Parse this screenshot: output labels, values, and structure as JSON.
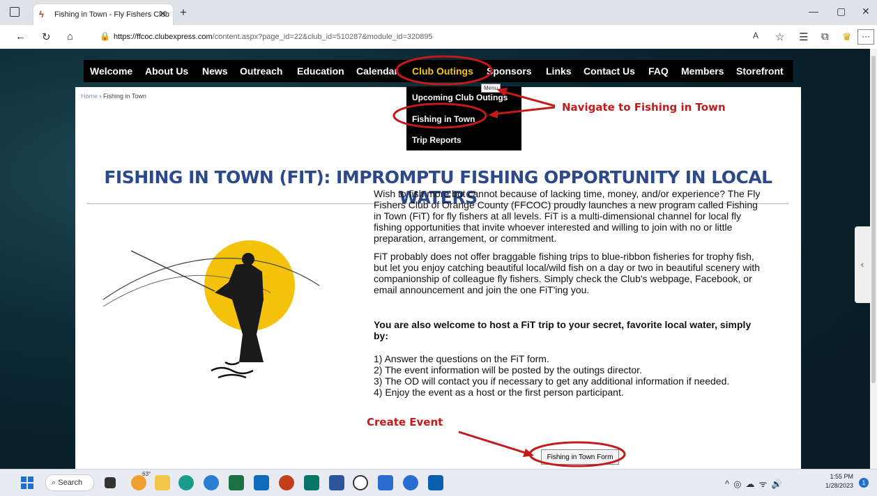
{
  "browser": {
    "tab_title": "Fishing in Town - Fly Fishers Club",
    "url_base": "https://ffcoc.clubexpress.com",
    "url_path": "/content.aspx?page_id=22&club_id=510287&module_id=320895"
  },
  "menu": {
    "items": [
      "Welcome",
      "About Us",
      "News",
      "Outreach",
      "Education",
      "Calendar",
      "Club Outings",
      "Sponsors",
      "Links",
      "Contact Us",
      "FAQ",
      "Members",
      "Storefront"
    ],
    "active": "Club Outings",
    "tooltip": "Menu"
  },
  "dropdown": {
    "items": [
      "Upcoming Club Outings",
      "Fishing in Town",
      "Trip Reports"
    ]
  },
  "breadcrumb": {
    "home": "Home",
    "current": "Fishing in Town"
  },
  "page": {
    "heading": "FISHING IN TOWN (FIT): IMPROMPTU FISHING OPPORTUNITY IN LOCAL WATERS",
    "para1": "Wish to fish more but cannot because of lacking time, money, and/or experience? The Fly Fishers Club of Orange County (FFCOC) proudly launches a new program called Fishing in Town (FiT) for fly fishers at all levels. FiT is a multi-dimensional channel for local fly fishing opportunities that invite whoever interested and willing to join with no or little preparation, arrangement, or commitment.",
    "para2": "FiT probably does not offer braggable fishing trips to blue-ribbon fisheries for trophy fish, but let you enjoy catching beautiful local/wild fish on a day or two in beautiful scenery with companionship of colleague fly fishers. Simply check the Club's webpage, Facebook, or email announcement and join the one FiT'ing you.",
    "host_heading": "You are also welcome to host a FiT trip to your secret, favorite local water, simply by:",
    "steps": [
      "1) Answer the questions on the FiT form.",
      "2) The event information will be posted by the outings director.",
      "3) The OD will contact you if necessary to get any additional information if needed.",
      "4)  Enjoy the event as a host or the first person participant."
    ],
    "form_button": "Fishing in Town Form"
  },
  "annotations": {
    "navigate": "Navigate to Fishing in Town",
    "create": "Create Event",
    "color": "#c41a1a"
  },
  "taskbar": {
    "search": "Search",
    "temp": "63°",
    "time": "1:55 PM",
    "date": "1/28/2023"
  },
  "colors": {
    "menu_active": "#f5c518",
    "heading": "#2c4a8a",
    "menubar": "#000000"
  }
}
